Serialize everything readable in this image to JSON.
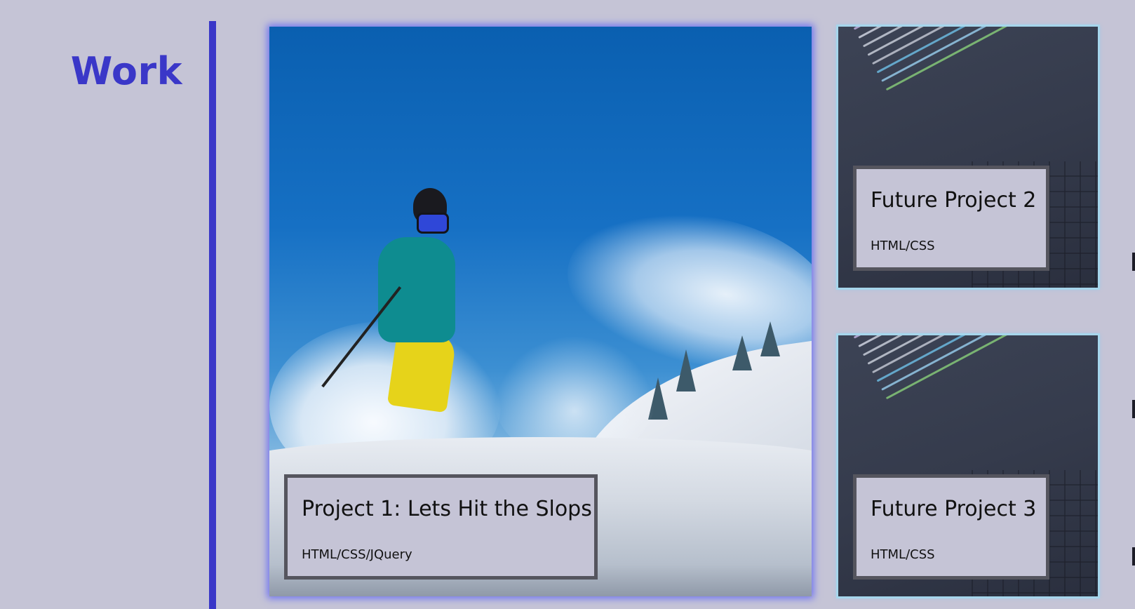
{
  "section": {
    "title": "Work"
  },
  "colors": {
    "accent": "#3a37c8",
    "background": "#c5c4d6",
    "main_card_glow": "#6f72f0",
    "small_card_border": "#a6d6ec",
    "caption_border": "#55555e"
  },
  "projects": [
    {
      "title": "Project 1: Lets Hit the Slops",
      "tech": "HTML/CSS/JQuery",
      "image": "skier-in-powder-snow"
    },
    {
      "title": "Future Project 2",
      "tech": "HTML/CSS",
      "image": "code-on-laptop-screen"
    },
    {
      "title": "Future Project 3",
      "tech": "HTML/CSS",
      "image": "code-on-laptop-screen"
    }
  ]
}
